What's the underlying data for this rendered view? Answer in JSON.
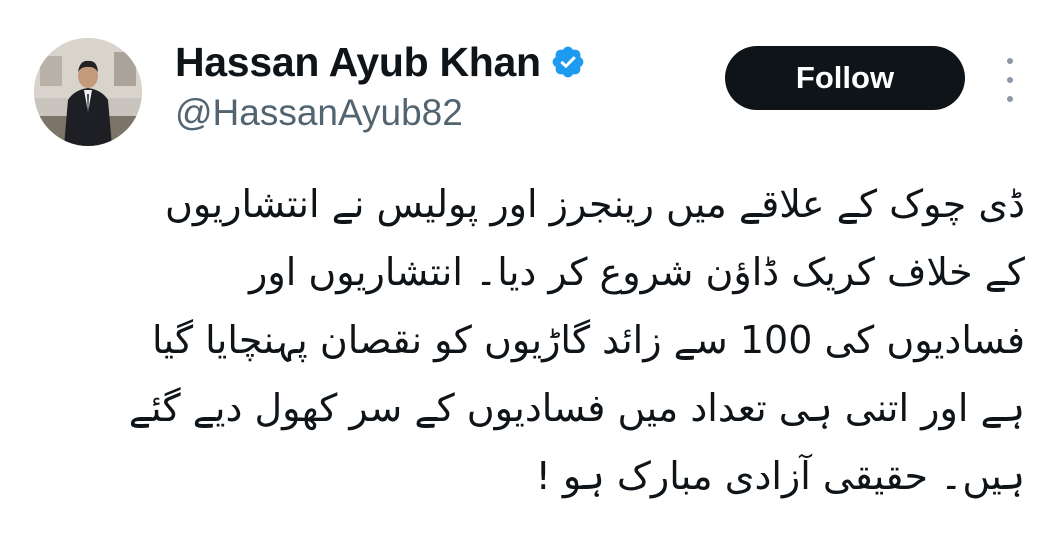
{
  "tweet": {
    "author": {
      "display_name": "Hassan Ayub Khan",
      "handle": "@HassanAyub82",
      "verified_icon": "verified-badge-icon",
      "verified_color": "#1d9bf0"
    },
    "follow_label": "Follow",
    "more_icon": "more-options-icon",
    "body_lines": [
      "ڈی چوک کے علاقے میں رینجرز اور پولیس نے انتشاریوں",
      "کے خلاف کریک ڈاؤن شروع کر دیا۔ انتشاریوں اور",
      "فسادیوں کی 100 سے زائد گاڑیوں کو نقصان پہنچایا گیا",
      "ہے اور اتنی ہی تعداد میں فسادیوں کے سر کھول دیے گئے",
      "ہیں۔ حقیقی آزادی مبارک ہو !"
    ]
  },
  "colors": {
    "text_primary": "#0f1419",
    "text_secondary": "#536471",
    "button_bg": "#0f1419",
    "button_text": "#ffffff"
  }
}
